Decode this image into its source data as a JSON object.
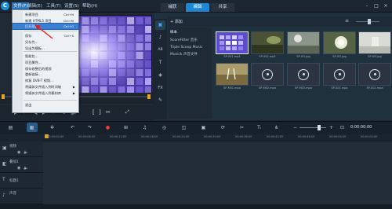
{
  "menubar": {
    "logo": "C",
    "items": [
      "文件(F)",
      "编辑(E)",
      "工具(T)",
      "设置(S)",
      "帮助(H)"
    ]
  },
  "workspace_tabs": [
    "捕获",
    "编辑",
    "共享"
  ],
  "window_controls": [
    "-",
    "□",
    "×"
  ],
  "file_menu": {
    "items": [
      {
        "label": "新建项目",
        "shortcut": "Ctrl+N"
      },
      {
        "label": "新建 HTML5 项目",
        "shortcut": "Ctrl+M"
      },
      {
        "label": "打开项目...",
        "shortcut": "Ctrl+O"
      },
      {
        "label": "保存",
        "shortcut": "Ctrl+S"
      },
      {
        "label": "另存为...",
        "shortcut": ""
      },
      {
        "label": "导出为模板...",
        "shortcut": ""
      },
      {
        "label": "智能包...",
        "shortcut": ""
      },
      {
        "label": "项目属性...",
        "shortcut": ""
      },
      {
        "label": "保存修整后的视频",
        "shortcut": ""
      },
      {
        "label": "重新链接...",
        "shortcut": ""
      },
      {
        "label": "修复 DVB-T 视频...",
        "shortcut": ""
      },
      {
        "label": "将媒体文件插入到时间轴",
        "shortcut": ""
      },
      {
        "label": "将媒体文件插入到素材库",
        "shortcut": ""
      },
      {
        "label": "退出",
        "shortcut": ""
      }
    ]
  },
  "library": {
    "add_label": "+ 添加",
    "folders": [
      "样本",
      "ScoreFitter 音乐",
      "Triple Scoop Music",
      "Musick 声音文件"
    ],
    "thumbs": [
      "SP-V01.mp4",
      "SP-V02.mp4",
      "SP-I01.jpg",
      "SP-I02.jpg",
      "SP-I03.jpg",
      "SP-M01.mpa",
      "SP-M02.mpa",
      "SP-M03.mpa",
      "SP-S01.mpa",
      "SP-S02.mpa"
    ],
    "tools": [
      "▣",
      "♪",
      "AB",
      "T",
      "◈",
      "FX",
      "✎"
    ]
  },
  "player": {
    "timecode": "00:00:00:00"
  },
  "timeline": {
    "ticks": [
      "00:00:00:00",
      "00:00:06:00",
      "00:00:12:00",
      "00:00:18:00",
      "00:00:24:00",
      "00:00:30:00",
      "00:00:36:00",
      "00:00:42:00",
      "00:00:48:00",
      "00:00:54:00",
      "00:01:00:00"
    ],
    "tracks": [
      "视频",
      "叠加1",
      "标题1",
      "声音"
    ],
    "timecode": "0:00:00:00"
  },
  "colors": {
    "accent": "#1f86d2",
    "highlight": "#3a7fd1",
    "arrow": "#e02020"
  }
}
